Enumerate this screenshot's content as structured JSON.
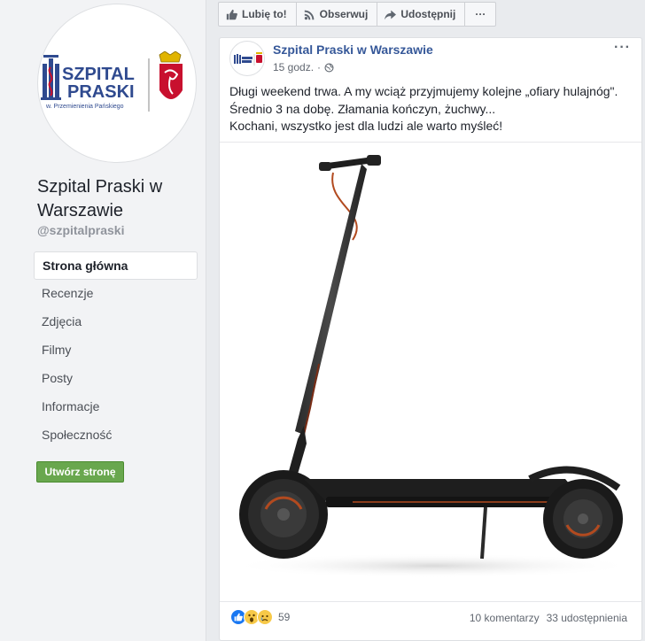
{
  "page": {
    "name": "Szpital Praski w Warszawie",
    "handle": "@szpitalpraski",
    "logo_text_line1": "SZPITAL",
    "logo_text_line2": "PRASKI",
    "logo_subtitle": "w. Przemienienia Pańskiego"
  },
  "sidebar": {
    "items": [
      {
        "label": "Strona główna"
      },
      {
        "label": "Recenzje"
      },
      {
        "label": "Zdjęcia"
      },
      {
        "label": "Filmy"
      },
      {
        "label": "Posty"
      },
      {
        "label": "Informacje"
      },
      {
        "label": "Społeczność"
      }
    ],
    "create_page_label": "Utwórz stronę"
  },
  "actions": {
    "like_label": "Lubię to!",
    "follow_label": "Obserwuj",
    "share_label": "Udostępnij",
    "more_label": "···"
  },
  "post": {
    "author": "Szpital Praski w Warszawie",
    "time": "15 godz.",
    "menu_label": "···",
    "text_line1": "Długi weekend trwa. A my wciąż przyjmujemy kolejne „ofiary hulajnóg\".",
    "text_line2": "Średnio 3 na dobę. Złamania kończyn, żuchwy...",
    "text_line3": "Kochani, wszystko jest dla ludzi ale warto myśleć!",
    "reactions_count": "59",
    "comments": "10 komentarzy",
    "shares": "33 udostępnienia",
    "reaction_icons": [
      "like-icon",
      "wow-icon",
      "sad-icon"
    ]
  },
  "colors": {
    "link": "#365899",
    "create_button": "#69a74e",
    "like_reaction": "#1877f2",
    "emoji_yellow": "#f7c948"
  }
}
